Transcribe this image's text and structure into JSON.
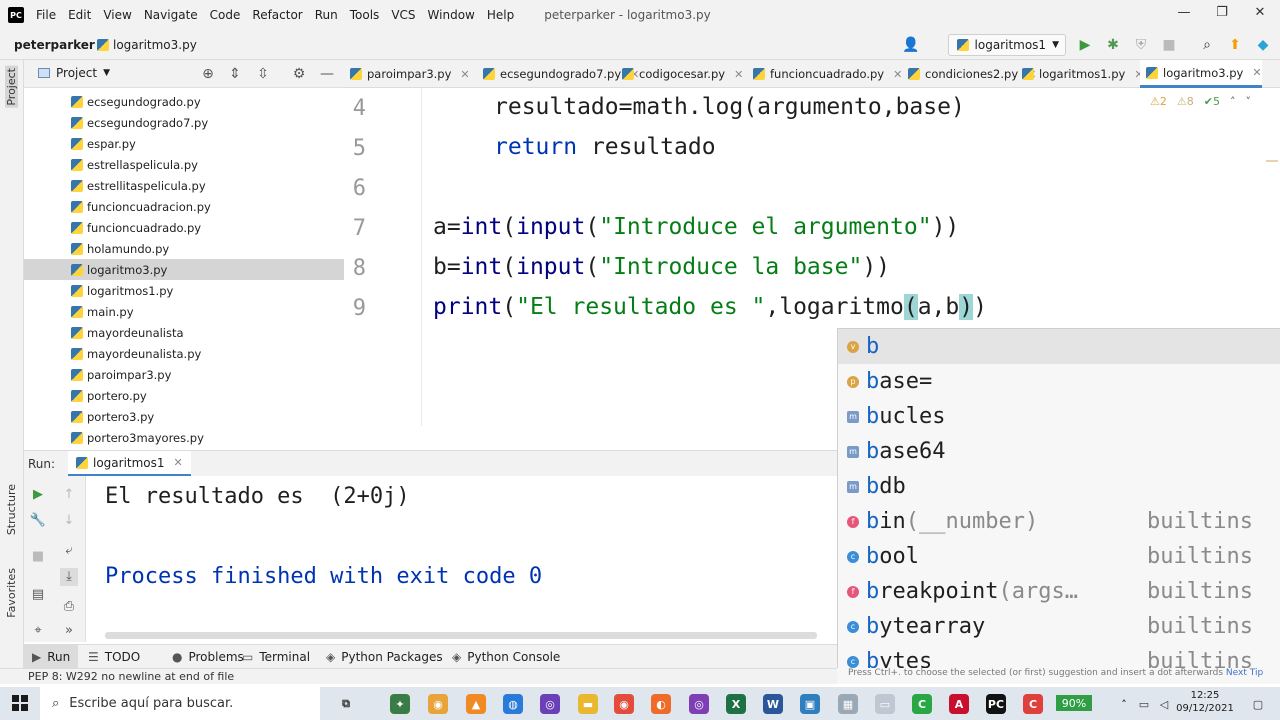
{
  "window": {
    "title": "peterparker - logaritmo3.py",
    "menu": [
      "File",
      "Edit",
      "View",
      "Navigate",
      "Code",
      "Refactor",
      "Run",
      "Tools",
      "VCS",
      "Window",
      "Help"
    ],
    "controls": {
      "minimize": "—",
      "maximize": "❐",
      "close": "✕"
    }
  },
  "navbar": {
    "project": "peterparker",
    "file": "logaritmo3.py",
    "run_config": "logaritmos1"
  },
  "left_stripe": {
    "project": "Project",
    "structure": "Structure",
    "favorites": "Favorites"
  },
  "project_panel": {
    "title": "Project",
    "files": [
      {
        "name": "ecsegundogrado.py",
        "selected": false
      },
      {
        "name": "ecsegundogrado7.py",
        "selected": false
      },
      {
        "name": "espar.py",
        "selected": false
      },
      {
        "name": "estrellaspelicula.py",
        "selected": false
      },
      {
        "name": "estrellitaspelicula.py",
        "selected": false
      },
      {
        "name": "funcioncuadracion.py",
        "selected": false
      },
      {
        "name": "funcioncuadrado.py",
        "selected": false
      },
      {
        "name": "holamundo.py",
        "selected": false
      },
      {
        "name": "logaritmo3.py",
        "selected": true
      },
      {
        "name": "logaritmos1.py",
        "selected": false
      },
      {
        "name": "main.py",
        "selected": false
      },
      {
        "name": "mayordeunalista",
        "selected": false
      },
      {
        "name": "mayordeunalista.py",
        "selected": false
      },
      {
        "name": "paroimpar3.py",
        "selected": false
      },
      {
        "name": "portero.py",
        "selected": false
      },
      {
        "name": "portero3.py",
        "selected": false
      },
      {
        "name": "portero3mayores.py",
        "selected": false
      }
    ]
  },
  "editor_tabs": [
    {
      "label": "paroimpar3.py",
      "active": false
    },
    {
      "label": "ecsegundogrado7.py",
      "active": false
    },
    {
      "label": "codigocesar.py",
      "active": false
    },
    {
      "label": "funcioncuadrado.py",
      "active": false
    },
    {
      "label": "condiciones2.py",
      "active": false
    },
    {
      "label": "logaritmos1.py",
      "active": false
    },
    {
      "label": "logaritmo3.py",
      "active": true
    }
  ],
  "inspections": {
    "warnings": "2",
    "weak_warnings": "8",
    "ok": "5"
  },
  "editor": {
    "line_numbers": [
      "4",
      "5",
      "6",
      "7",
      "8",
      "9"
    ],
    "line4": {
      "text": "resultado=math.log(argumento,base)"
    },
    "line5": {
      "kw": "return",
      "rest": " resultado"
    },
    "line7": {
      "a": "a=",
      "int": "int",
      "p1": "(",
      "input": "input",
      "p2": "(",
      "str": "\"Introduce el argumento\"",
      "close": "))"
    },
    "line8": {
      "a": "b=",
      "int": "int",
      "p1": "(",
      "input": "input",
      "p2": "(",
      "str": "\"Introduce la base\"",
      "close": "))"
    },
    "line9": {
      "print": "print",
      "p1": "(",
      "str": "\"El resultado es \"",
      "comma": ",",
      "call": "logaritmo",
      "po": "(",
      "args": "a,b",
      "pc": ")",
      "close": ")"
    }
  },
  "completion": {
    "items": [
      {
        "badge": "v",
        "match": "b",
        "rest": "",
        "tail": "",
        "source": ""
      },
      {
        "badge": "p",
        "match": "b",
        "rest": "ase=",
        "tail": "",
        "source": ""
      },
      {
        "badge": "m",
        "match": "b",
        "rest": "ucles",
        "tail": "",
        "source": ""
      },
      {
        "badge": "m",
        "match": "b",
        "rest": "ase64",
        "tail": "",
        "source": ""
      },
      {
        "badge": "m",
        "match": "b",
        "rest": "db",
        "tail": "",
        "source": ""
      },
      {
        "badge": "f",
        "match": "b",
        "rest": "in",
        "tail": "(__number)",
        "source": "builtins"
      },
      {
        "badge": "c",
        "match": "b",
        "rest": "ool",
        "tail": "",
        "source": "builtins"
      },
      {
        "badge": "f",
        "match": "b",
        "rest": "reakpoint",
        "tail": "(args…",
        "source": "builtins"
      },
      {
        "badge": "c",
        "match": "b",
        "rest": "ytearray",
        "tail": "",
        "source": "builtins"
      },
      {
        "badge": "c",
        "match": "b",
        "rest": "ytes",
        "tail": "",
        "source": "builtins"
      }
    ],
    "hint": "Press Ctrl+. to choose the selected (or first) suggestion and insert a dot afterwards",
    "next_tip": "Next Tip"
  },
  "run_panel": {
    "label": "Run:",
    "tab": "logaritmos1",
    "output": [
      "El resultado es  (2+0j)",
      "Process finished with exit code 0"
    ]
  },
  "bottom_tabs": [
    {
      "label": "Run",
      "icon": "▶",
      "active": true
    },
    {
      "label": "TODO",
      "icon": "☰",
      "active": false
    },
    {
      "label": "Problems",
      "icon": "●",
      "active": false
    },
    {
      "label": "Terminal",
      "icon": "▭",
      "active": false
    },
    {
      "label": "Python Packages",
      "icon": "◈",
      "active": false
    },
    {
      "label": "Python Console",
      "icon": "◈",
      "active": false
    }
  ],
  "status": {
    "message": "PEP 8: W292 no newline at end of file"
  },
  "taskbar": {
    "search_placeholder": "Escribe aquí para buscar.",
    "battery": "90%",
    "time": "12:25",
    "date": "09/12/2021"
  },
  "colors": {
    "accent": "#4083c9",
    "string": "#067d17",
    "keyword": "#0033b3",
    "match": "#1764c4"
  }
}
